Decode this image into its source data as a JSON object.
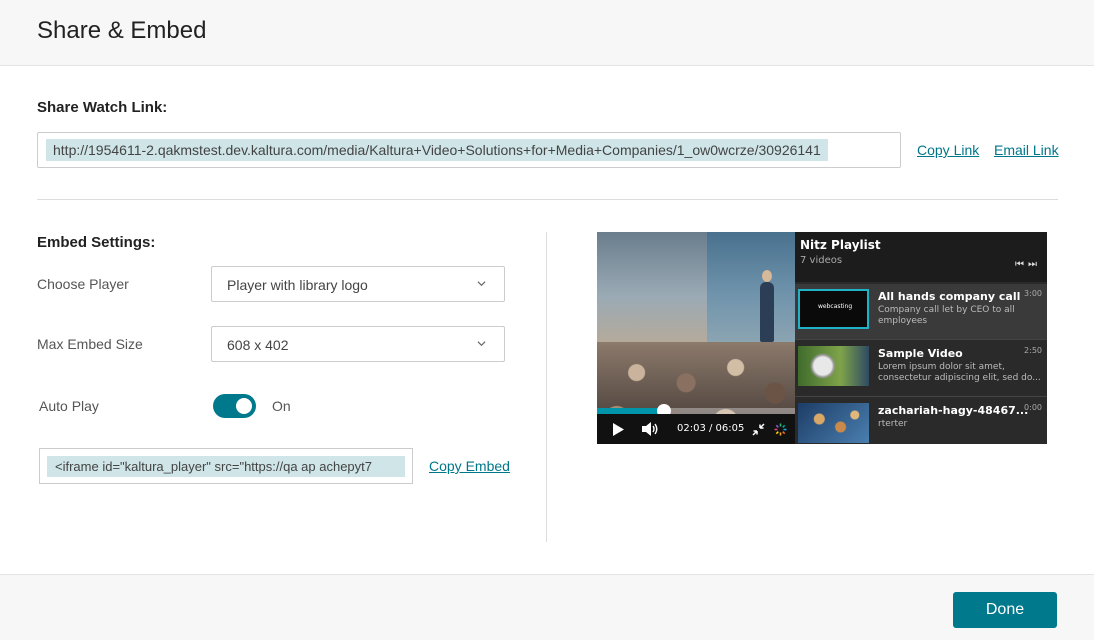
{
  "dialog": {
    "title": "Share & Embed"
  },
  "share": {
    "label": "Share Watch Link:",
    "url": "http://1954611-2.qakmstest.dev.kaltura.com/media/Kaltura+Video+Solutions+for+Media+Companies/1_ow0wcrze/30926141",
    "copy_link": "Copy Link",
    "email_link": "Email Link"
  },
  "embed": {
    "label": "Embed Settings:",
    "choose_player_label": "Choose Player",
    "choose_player_value": "Player with library logo",
    "max_size_label": "Max Embed Size",
    "max_size_value": "608 x 402",
    "autoplay_label": "Auto Play",
    "autoplay_state": "On",
    "code": "<iframe id=\"kaltura_player\" src=\"https://qa ap achepyt7",
    "copy_embed": "Copy Embed"
  },
  "preview": {
    "current_time": "02:03",
    "total_time": "06:05",
    "time_display": "02:03 / 06:05",
    "progress_fraction": 0.34,
    "playlist_title": "Nitz Playlist",
    "playlist_count": "7 videos",
    "items": [
      {
        "name": "All hands company call",
        "desc": "Company call let by CEO to all employees",
        "duration": "3:00",
        "thumb_text": "webcasting"
      },
      {
        "name": "Sample Video",
        "desc": "Lorem ipsum dolor sit amet, consectetur adipiscing elit, sed do...",
        "duration": "2:50"
      },
      {
        "name": "zachariah-hagy-48467...",
        "desc": "rterter",
        "duration": "0:00"
      }
    ]
  },
  "footer": {
    "done_label": "Done"
  },
  "colors": {
    "accent": "#00798c",
    "selection": "#cfe5e8",
    "link": "#00768a"
  }
}
